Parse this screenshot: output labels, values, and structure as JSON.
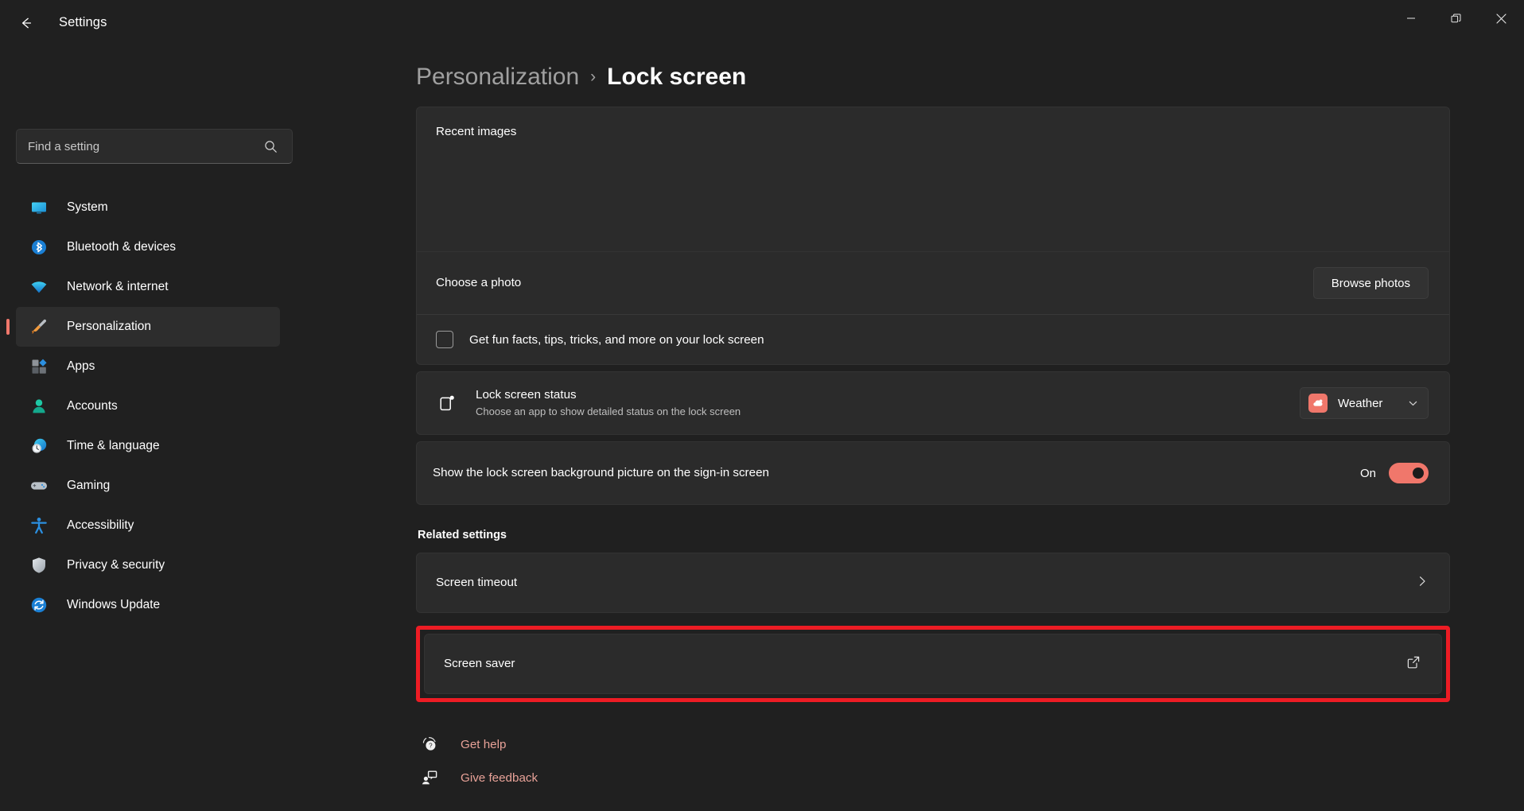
{
  "window": {
    "title": "Settings",
    "back_icon": "arrow-left-icon",
    "controls": {
      "minimize": "minimize-icon",
      "maximize": "maximize-restore-icon",
      "close": "close-icon"
    }
  },
  "search": {
    "placeholder": "Find a setting",
    "value": "",
    "icon": "search-icon"
  },
  "sidebar": {
    "items": [
      {
        "label": "System",
        "icon": "system-monitor-icon",
        "selected": false
      },
      {
        "label": "Bluetooth & devices",
        "icon": "bluetooth-icon",
        "selected": false
      },
      {
        "label": "Network & internet",
        "icon": "wifi-icon",
        "selected": false
      },
      {
        "label": "Personalization",
        "icon": "paintbrush-icon",
        "selected": true
      },
      {
        "label": "Apps",
        "icon": "apps-grid-icon",
        "selected": false
      },
      {
        "label": "Accounts",
        "icon": "person-icon",
        "selected": false
      },
      {
        "label": "Time & language",
        "icon": "clock-globe-icon",
        "selected": false
      },
      {
        "label": "Gaming",
        "icon": "gamepad-icon",
        "selected": false
      },
      {
        "label": "Accessibility",
        "icon": "accessibility-person-icon",
        "selected": false
      },
      {
        "label": "Privacy & security",
        "icon": "shield-icon",
        "selected": false
      },
      {
        "label": "Windows Update",
        "icon": "update-refresh-icon",
        "selected": false
      }
    ]
  },
  "breadcrumb": {
    "parent": "Personalization",
    "separator": "›",
    "current": "Lock screen"
  },
  "main": {
    "recent_images_label": "Recent images",
    "choose_photo": {
      "label": "Choose a photo",
      "button_label": "Browse photos"
    },
    "fun_facts": {
      "label": "Get fun facts, tips, tricks, and more on your lock screen",
      "checked": false
    },
    "lock_screen_status": {
      "icon": "lock-screen-status-icon",
      "title": "Lock screen status",
      "subtitle": "Choose an app to show detailed status on the lock screen",
      "dropdown_value": "Weather",
      "dropdown_app_icon": "weather-cloud-icon",
      "chevron_icon": "chevron-down-icon"
    },
    "background_on_signin": {
      "label": "Show the lock screen background picture on the sign-in screen",
      "state_label": "On",
      "toggle_on": true
    },
    "related_settings_heading": "Related settings",
    "related": [
      {
        "label": "Screen timeout",
        "action_icon": "chevron-right-icon",
        "highlighted": false
      },
      {
        "label": "Screen saver",
        "action_icon": "open-external-icon",
        "highlighted": true
      }
    ]
  },
  "footer": {
    "links": [
      {
        "label": "Get help",
        "icon": "help-question-icon"
      },
      {
        "label": "Give feedback",
        "icon": "feedback-person-icon"
      }
    ]
  },
  "colors": {
    "accent": "#f0776b",
    "link": "#e8a298",
    "annotation_highlight": "#ed1c24",
    "window_background": "#202020",
    "card_background": "#2b2b2b"
  }
}
